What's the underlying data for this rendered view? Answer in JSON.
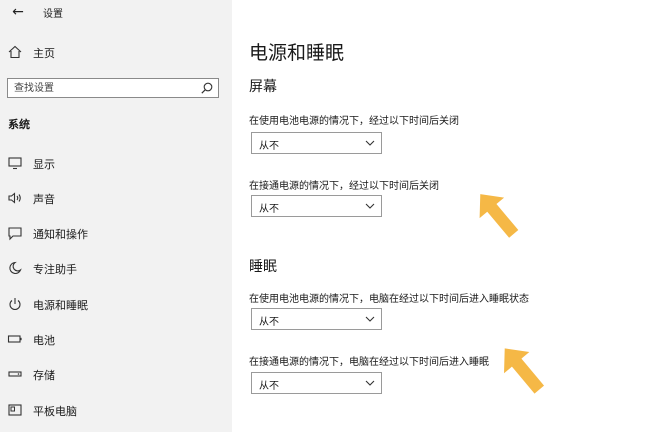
{
  "window": {
    "title": "设置",
    "back_icon": "back-arrow-icon"
  },
  "sidebar": {
    "home": {
      "label": "主页",
      "icon": "home-icon"
    },
    "search": {
      "placeholder": "查找设置",
      "icon": "search-icon"
    },
    "section_title": "系统",
    "items": [
      {
        "label": "显示",
        "icon": "display-icon"
      },
      {
        "label": "声音",
        "icon": "speaker-icon"
      },
      {
        "label": "通知和操作",
        "icon": "notification-icon"
      },
      {
        "label": "专注助手",
        "icon": "moon-icon"
      },
      {
        "label": "电源和睡眠",
        "icon": "power-icon"
      },
      {
        "label": "电池",
        "icon": "battery-icon"
      },
      {
        "label": "存储",
        "icon": "storage-icon"
      },
      {
        "label": "平板电脑",
        "icon": "tablet-icon"
      }
    ]
  },
  "main": {
    "title": "电源和睡眠",
    "screen": {
      "heading": "屏幕",
      "battery_label": "在使用电池电源的情况下，经过以下时间后关闭",
      "battery_value": "从不",
      "plugged_label": "在接通电源的情况下，经过以下时间后关闭",
      "plugged_value": "从不"
    },
    "sleep": {
      "heading": "睡眠",
      "battery_label": "在使用电池电源的情况下，电脑在经过以下时间后进入睡眠状态",
      "battery_value": "从不",
      "plugged_label": "在接通电源的情况下，电脑在经过以下时间后进入睡眠",
      "plugged_value": "从不"
    }
  },
  "colors": {
    "sidebar_bg": "#f2f2f2",
    "annotation_arrow": "#f5b846"
  }
}
